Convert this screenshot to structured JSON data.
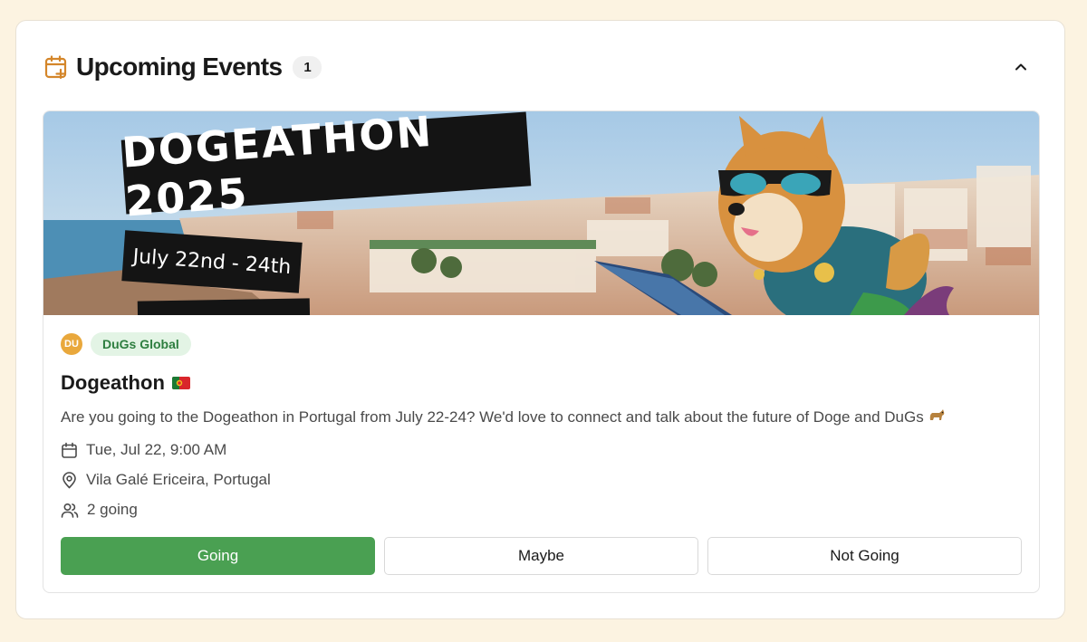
{
  "panel": {
    "title": "Upcoming Events",
    "count": "1"
  },
  "event": {
    "banner": {
      "title": "DOGEATHON 2025",
      "dates": "July 22nd - 24th"
    },
    "org": {
      "avatar_initials": "DU",
      "name": "DuGs Global"
    },
    "title": "Dogeathon",
    "title_flag_icon": "portugal-flag-icon",
    "description": "Are you going to the Dogeathon in Portugal from July 22-24? We'd love to connect and talk about the future of Doge and DuGs",
    "description_icon": "dog-emoji-icon",
    "datetime": "Tue, Jul 22, 9:00 AM",
    "location": "Vila Galé Ericeira, Portugal",
    "attendees": "2 going"
  },
  "rsvp": {
    "going": "Going",
    "maybe": "Maybe",
    "not_going": "Not Going",
    "selected": "going"
  },
  "colors": {
    "page_bg": "#fcf3e1",
    "accent_orange": "#d4862a",
    "going_green": "#4aa052",
    "org_badge_bg": "#e3f4e5",
    "org_badge_text": "#2d7e3f"
  }
}
